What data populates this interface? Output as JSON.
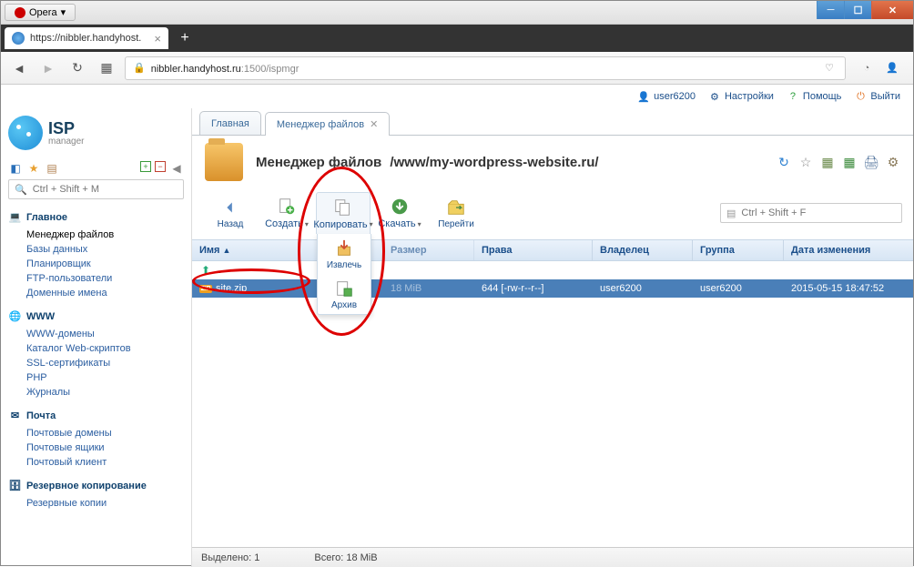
{
  "window": {
    "opera_label": "Opera",
    "tab_title": "https://nibbler.handyhost.",
    "address_host": "nibbler.handyhost.ru",
    "address_rest": ":1500/ispmgr"
  },
  "header": {
    "user": "user6200",
    "settings": "Настройки",
    "help": "Помощь",
    "logout": "Выйти"
  },
  "logo": {
    "line1": "ISP",
    "line2": "manager"
  },
  "sidebar": {
    "search_placeholder": "Ctrl + Shift + M",
    "groups": [
      {
        "title": "Главное",
        "icon": "home",
        "items": [
          "Менеджер файлов",
          "Базы данных",
          "Планировщик",
          "FTP-пользователи",
          "Доменные имена"
        ],
        "active_index": 0
      },
      {
        "title": "WWW",
        "icon": "globe",
        "items": [
          "WWW-домены",
          "Каталог Web-скриптов",
          "SSL-сертификаты",
          "PHP",
          "Журналы"
        ]
      },
      {
        "title": "Почта",
        "icon": "mail",
        "items": [
          "Почтовые домены",
          "Почтовые ящики",
          "Почтовый клиент"
        ]
      },
      {
        "title": "Резервное копирование",
        "icon": "backup",
        "items": [
          "Резервные копии"
        ]
      }
    ]
  },
  "tabs": {
    "main": "Главная",
    "active": "Менеджер файлов"
  },
  "page": {
    "title": "Менеджер файлов",
    "path": "/www/my-wordpress-website.ru/"
  },
  "toolbar": {
    "back": "Назад",
    "create": "Создать",
    "copy": "Копировать",
    "download": "Скачать",
    "goto": "Перейти",
    "search_placeholder": "Ctrl + Shift + F",
    "dropdown": {
      "extract": "Извлечь",
      "archive": "Архив"
    }
  },
  "table": {
    "headers": {
      "name": "Имя",
      "size": "Размер",
      "perm": "Права",
      "owner": "Владелец",
      "group": "Группа",
      "date": "Дата изменения"
    },
    "up_row": "..",
    "rows": [
      {
        "name": "site.zip",
        "size": "18 MiB",
        "perm": "644 [-rw-r--r--]",
        "owner": "user6200",
        "group": "user6200",
        "date": "2015-05-15 18:47:52",
        "selected": true
      }
    ]
  },
  "status": {
    "selected": "Выделено: 1",
    "total": "Всего: 18 MiB"
  },
  "colors": {
    "accent": "#1a4e8a",
    "sel_row": "#4a7fb8",
    "red": "#d00"
  }
}
